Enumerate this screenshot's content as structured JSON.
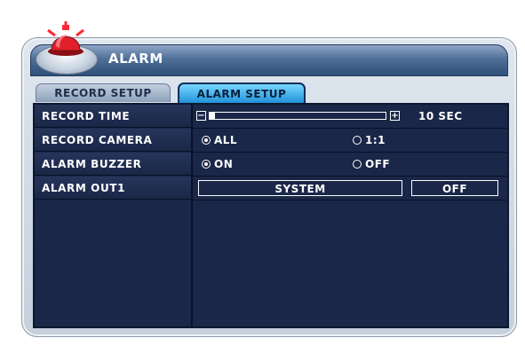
{
  "header": {
    "title": "ALARM",
    "icon": "siren-icon"
  },
  "tabs": [
    {
      "label": "RECORD SETUP",
      "active": false
    },
    {
      "label": "ALARM SETUP",
      "active": true
    }
  ],
  "rows": {
    "record_time": {
      "label": "RECORD TIME",
      "value_text": "10 SEC",
      "slider_level_fraction": 0.03,
      "minus_symbol": "−",
      "plus_symbol": "+"
    },
    "record_camera": {
      "label": "RECORD CAMERA",
      "options": [
        {
          "label": "ALL",
          "selected": true
        },
        {
          "label": "1:1",
          "selected": false
        }
      ]
    },
    "alarm_buzzer": {
      "label": "ALARM BUZZER",
      "options": [
        {
          "label": "ON",
          "selected": true
        },
        {
          "label": "OFF",
          "selected": false
        }
      ]
    },
    "alarm_out1": {
      "label": "ALARM OUT1",
      "mode": "SYSTEM",
      "state": "OFF"
    }
  },
  "colors": {
    "panel_bg": "#1a2748",
    "active_tab": "#1d8fd8",
    "siren_red": "#e0202a"
  }
}
